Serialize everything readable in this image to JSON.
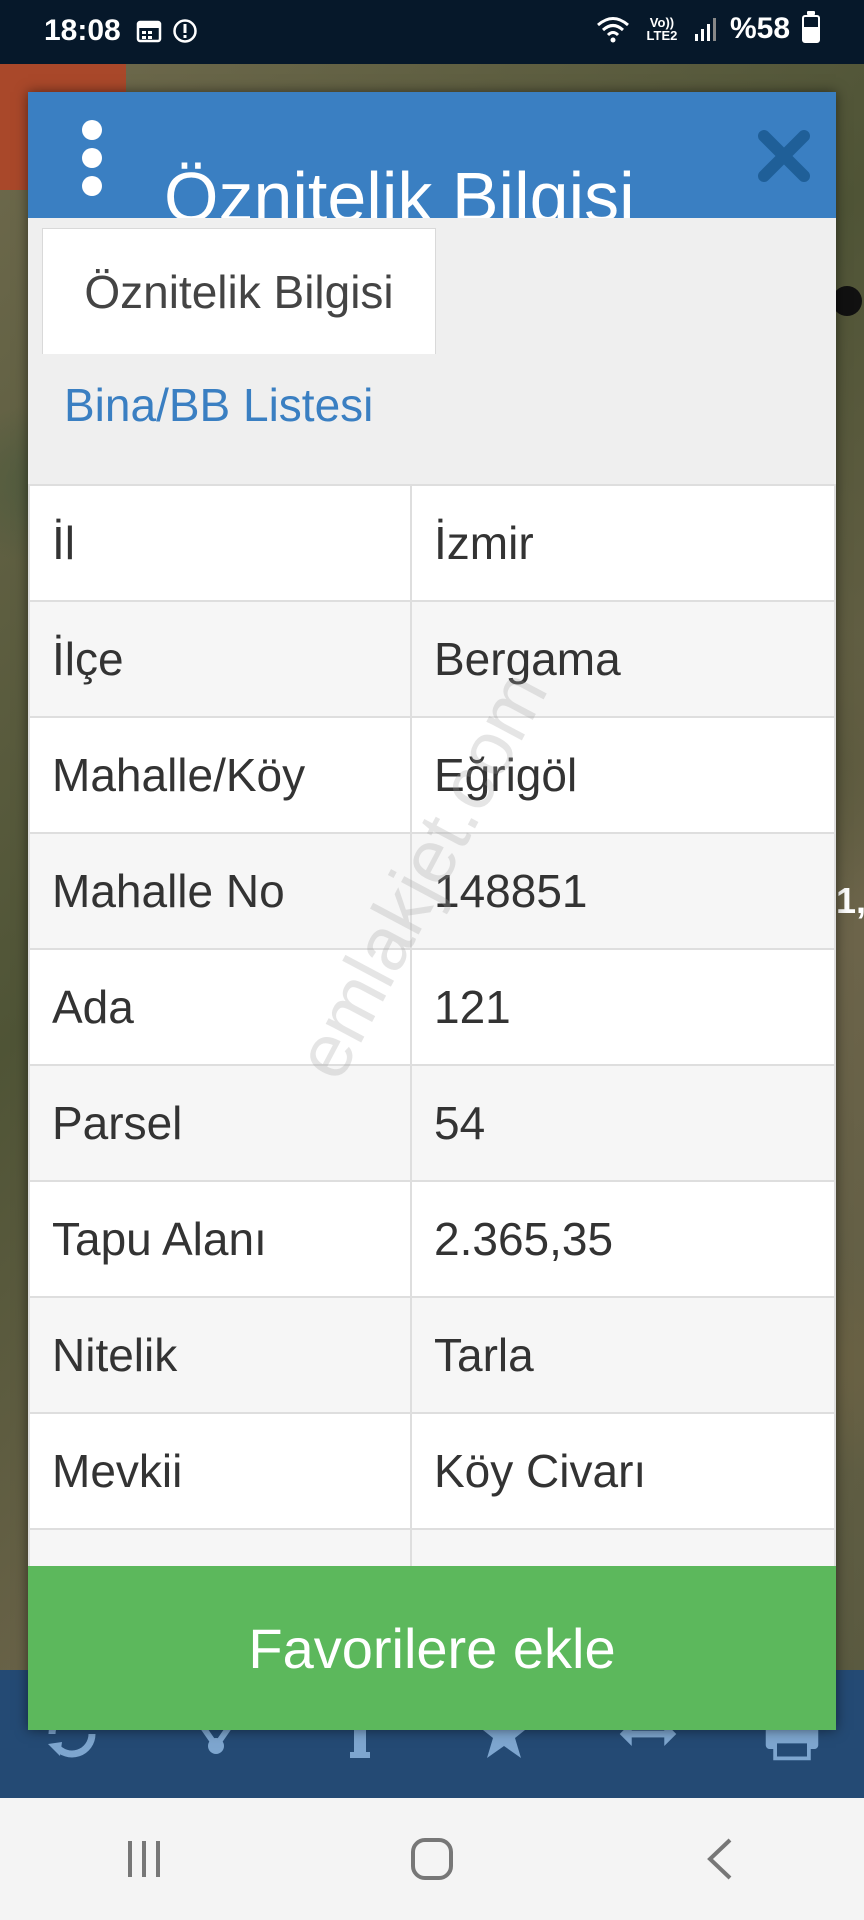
{
  "status_bar": {
    "time": "18:08",
    "network": "Vo)) LTE2",
    "battery": "%58",
    "battery_level": 0.58
  },
  "map": {
    "parcel_label": "1,"
  },
  "modal": {
    "title": "Öznitelik Bilgisi",
    "tabs": [
      {
        "label": "Öznitelik Bilgisi",
        "active": true
      },
      {
        "label": "Bina/BB Listesi",
        "active": false
      }
    ],
    "rows": [
      {
        "key": "İl",
        "value": "İzmir"
      },
      {
        "key": "İlçe",
        "value": "Bergama"
      },
      {
        "key": "Mahalle/Köy",
        "value": "Eğrigöl"
      },
      {
        "key": "Mahalle No",
        "value": "148851"
      },
      {
        "key": "Ada",
        "value": "121"
      },
      {
        "key": "Parsel",
        "value": "54"
      },
      {
        "key": "Tapu Alanı",
        "value": "2.365,35"
      },
      {
        "key": "Nitelik",
        "value": "Tarla"
      },
      {
        "key": "Mevkii",
        "value": "Köy Civarı"
      },
      {
        "key": "",
        "value": ""
      }
    ],
    "favorite_button": "Favorilere ekle"
  },
  "watermark": "emlakjet.com",
  "toolbar_icons": [
    "refresh-icon",
    "share-network-icon",
    "info-icon",
    "star-icon",
    "measure-arrows-icon",
    "print-icon"
  ],
  "nav_icons": [
    "recent-apps-icon",
    "home-icon",
    "back-icon"
  ],
  "colors": {
    "header_blue": "#3a7fc2",
    "favorite_green": "#5cb85c",
    "toolbar_blue": "#244a74"
  }
}
